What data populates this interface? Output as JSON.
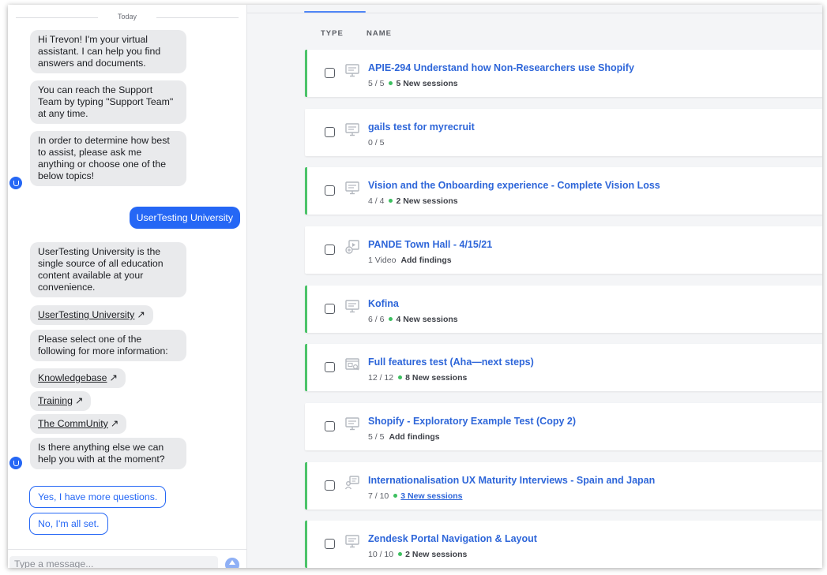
{
  "chat": {
    "date_separator": "Today",
    "messages": [
      "Hi Trevon! I'm your virtual assistant. I can help you find answers and documents.",
      "You can reach the Support Team by typing \"Support Team\" at any time.",
      "In order to determine how best to assist, please ask me anything or choose one of the below topics!"
    ],
    "user_message": "UserTesting University",
    "reply_text": "UserTesting University is the single source of all education content available at your convenience.",
    "reply_link": "UserTesting University",
    "select_prompt": "Please select one of the following for more information:",
    "links": [
      "Knowledgebase",
      "Training",
      "The CommUnity"
    ],
    "followup": "Is there anything else we can help you with at the moment?",
    "quick_replies": [
      "Yes, I have more questions.",
      "No, I'm all set."
    ],
    "composer_placeholder": "Type a message...",
    "external_glyph": "↗"
  },
  "list": {
    "columns": {
      "type": "TYPE",
      "name": "NAME"
    },
    "items": [
      {
        "title": "APIE-294 Understand how Non-Researchers use Shopify",
        "progress": "5 / 5",
        "status": "5 New sessions",
        "icon": "desktop-test-icon"
      },
      {
        "title": "gails test for myrecruit",
        "progress": "0 / 5",
        "status": "",
        "icon": "desktop-test-icon"
      },
      {
        "title": "Vision and the Onboarding experience - Complete Vision Loss",
        "progress": "4 / 4",
        "status": "2 New sessions",
        "icon": "desktop-test-icon"
      },
      {
        "title": "PANDE Town Hall - 4/15/21",
        "progress": "1 Video",
        "status": "Add findings",
        "icon": "video-upload-icon"
      },
      {
        "title": "Kofina",
        "progress": "6 / 6",
        "status": "4 New sessions",
        "icon": "desktop-test-icon"
      },
      {
        "title": "Full features test (Aha—next steps)",
        "progress": "12 / 12",
        "status": "8 New sessions",
        "icon": "prototype-test-icon"
      },
      {
        "title": "Shopify - Exploratory Example Test (Copy 2)",
        "progress": "5 / 5",
        "status": "Add findings",
        "icon": "desktop-test-icon"
      },
      {
        "title": "Internationalisation UX Maturity Interviews - Spain and Japan",
        "progress": "7 / 10",
        "status": "3 New sessions",
        "icon": "interview-test-icon"
      },
      {
        "title": "Zendesk Portal Navigation & Layout",
        "progress": "10 / 10",
        "status": "2 New sessions",
        "icon": "desktop-test-icon"
      }
    ]
  },
  "colors": {
    "accent_blue": "#2567f5",
    "title_blue": "#2e66d9",
    "active_green": "#4cc36a"
  }
}
